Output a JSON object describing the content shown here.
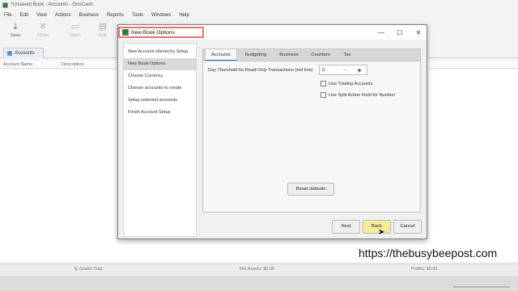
{
  "window": {
    "title": "*Unsaved Book - Accounts - GnuCash"
  },
  "menu": [
    "File",
    "Edit",
    "View",
    "Actions",
    "Business",
    "Reports",
    "Tools",
    "Windows",
    "Help"
  ],
  "toolbar": {
    "save": "Save",
    "close": "Close",
    "open": "Open",
    "edit": "Edit"
  },
  "accounts_tab": {
    "label": "Accounts"
  },
  "columns": {
    "account_name": "Account Name",
    "description": "Description"
  },
  "status": {
    "grand_total": "$, Grand Total:",
    "net_assets": "Net Assets: $0.00",
    "profits": "Profits: $0.00"
  },
  "dialog": {
    "title": "New Book Options",
    "steps": [
      "New Account Hierarchy Setup",
      "New Book Options",
      "Choose Currency",
      "Choose accounts to create",
      "Setup selected accounts",
      "Finish Account Setup"
    ],
    "active_step": 1,
    "tabs": [
      "Accounts",
      "Budgeting",
      "Business",
      "Counters",
      "Tax"
    ],
    "threshold_label": "Day Threshold for Read-Only Transactions (red line)",
    "threshold_value": "0",
    "trading_accounts": "Use Trading Accounts",
    "split_action": "Use Split Action Field for Number",
    "reset_button": "Reset defaults",
    "next_button": "Next",
    "back_button": "Back",
    "cancel_button": "Cancel"
  },
  "watermark": "https://thebusybeepost.com",
  "colors": {
    "highlight": "#e57373",
    "tab_underline": "#2f6fb0",
    "back_hover": "#f6eb9a"
  }
}
